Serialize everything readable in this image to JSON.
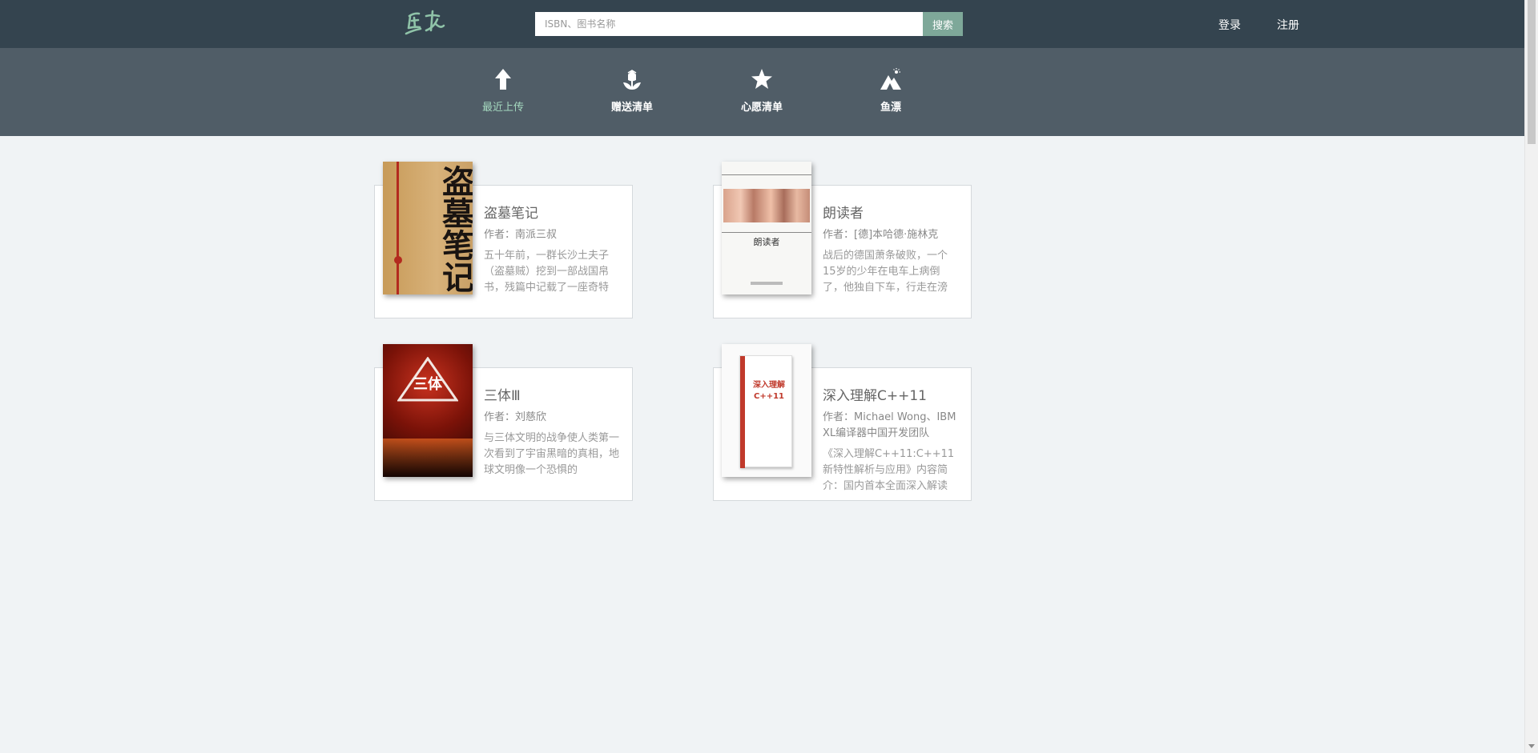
{
  "header": {
    "logo_text": "鱼书",
    "search_placeholder": "ISBN、图书名称",
    "search_button": "搜索",
    "login": "登录",
    "register": "注册"
  },
  "nav": {
    "items": [
      {
        "label": "最近上传",
        "icon": "arrow-up-icon",
        "active": true
      },
      {
        "label": "赠送清单",
        "icon": "flower-icon",
        "active": false
      },
      {
        "label": "心愿清单",
        "icon": "star-icon",
        "active": false
      },
      {
        "label": "鱼漂",
        "icon": "mountain-icon",
        "active": false
      }
    ]
  },
  "books": [
    {
      "title": "盗墓笔记",
      "author": "作者：南派三叔",
      "summary": "五十年前，一群长沙土夫子（盗墓贼）挖到一部战国帛书，残篇中记载了一座奇特",
      "cover_text": "盗墓笔记"
    },
    {
      "title": "朗读者",
      "author": "作者：[德]本哈德·施林克",
      "summary": "战后的德国萧条破败，一个15岁的少年在电车上病倒了，他独自下车，行走在滂",
      "cover_text": "朗读者"
    },
    {
      "title": "三体Ⅲ",
      "author": "作者：刘慈欣",
      "summary": "与三体文明的战争使人类第一次看到了宇宙黑暗的真相，地球文明像一个恐惧的",
      "cover_text": "三体"
    },
    {
      "title": "深入理解C++11",
      "author": "作者：Michael Wong、IBM XL编译器中国开发团队",
      "summary": "《深入理解C++11:C++11新特性解析与应用》内容简介：国内首本全面深入解读",
      "cover_text": "深入理解C++11"
    }
  ],
  "colors": {
    "topbar": "#34444f",
    "navbar": "#505d67",
    "accent": "#7ea899",
    "active_nav": "#a6dac0"
  }
}
